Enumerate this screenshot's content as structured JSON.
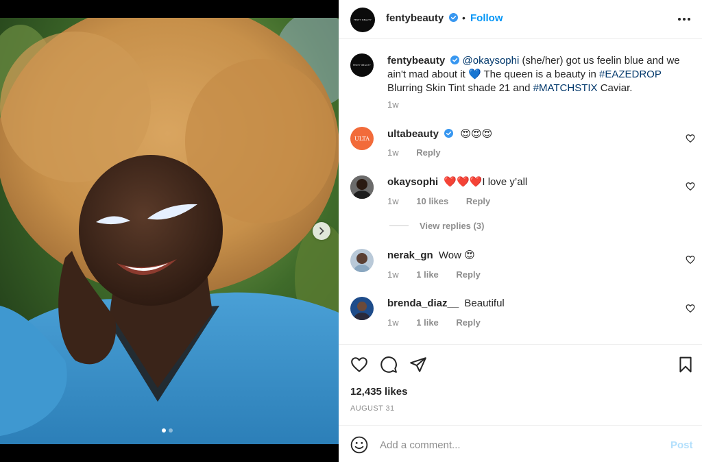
{
  "post": {
    "author": "fentybeauty",
    "avatar_text": "FENTY BEAUTY",
    "separator": "•",
    "follow_label": "Follow",
    "caption": {
      "author": "fentybeauty",
      "mention": "@okaysophi",
      "part1": " (she/her) got us feelin blue and we ain't mad about it ",
      "emoji": "💙",
      "part2": " The queen is a beauty in ",
      "tag1": "#EAZEDROP",
      "part3": " Blurring Skin Tint shade 21 and ",
      "tag2": "#MATCHSTIX",
      "part4": " Caviar.",
      "time": "1w"
    },
    "likes": "12,435 likes",
    "date": "AUGUST 31"
  },
  "comments": [
    {
      "user": "ultabeauty",
      "avatar_text": "ULTA",
      "text": "😍😍😍",
      "time": "1w",
      "likes": "",
      "reply_label": "Reply"
    },
    {
      "user": "okaysophi",
      "text": "❤️❤️❤️I love y’all",
      "time": "1w",
      "likes": "10 likes",
      "reply_label": "Reply"
    },
    {
      "user": "nerak_gn",
      "text": "Wow 😍",
      "time": "1w",
      "likes": "1 like",
      "reply_label": "Reply"
    },
    {
      "user": "brenda_diaz__",
      "text": "Beautiful",
      "time": "1w",
      "likes": "1 like",
      "reply_label": "Reply"
    }
  ],
  "view_replies": "View replies (3)",
  "add_comment": {
    "placeholder": "Add a comment...",
    "post_label": "Post"
  },
  "carousel": {
    "current": 1,
    "total": 2
  },
  "icons": [
    "verified-icon",
    "more-icon",
    "heart-icon",
    "comment-icon",
    "share-icon",
    "bookmark-icon",
    "emoji-icon",
    "chevron-right-icon"
  ],
  "colors": {
    "link": "#0095f6",
    "hashtag": "#00376b",
    "muted": "#8e8e8e",
    "verified": "#3897f0"
  }
}
